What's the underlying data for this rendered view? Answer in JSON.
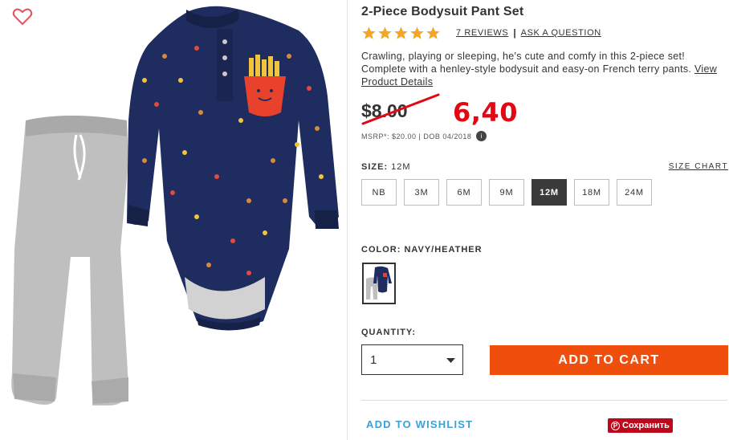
{
  "product": {
    "title": "2-Piece Bodysuit Pant Set",
    "rating": 5,
    "reviews_label": "7 REVIEWS",
    "separator": "|",
    "ask_label": "ASK A QUESTION",
    "description": "Crawling, playing or sleeping, he's cute and comfy in this 2-piece set! Complete with a henley-style bodysuit and easy-on French terry pants.",
    "details_link": "View Product Details"
  },
  "price": {
    "original": "$8.00",
    "handwritten_new": "6,40",
    "msrp_text": "MSRP*: $20.00 | DOB 04/2018",
    "info_icon": "i"
  },
  "size": {
    "label": "SIZE:",
    "selected": "12M",
    "chart_link": "SIZE CHART",
    "options": [
      "NB",
      "3M",
      "6M",
      "9M",
      "12M",
      "18M",
      "24M"
    ],
    "selected_index": 4
  },
  "color": {
    "label": "COLOR: NAVY/HEATHER"
  },
  "quantity": {
    "label": "QUANTITY:",
    "value": "1"
  },
  "actions": {
    "add_to_cart": "ADD TO CART",
    "wishlist": "ADD TO WISHLIST",
    "pinterest_save": "Сохранить",
    "pinterest_icon": "P"
  },
  "icons": {
    "favorite": "heart-outline-icon",
    "star": "star-icon",
    "dropdown": "caret-down-icon",
    "info": "info-icon",
    "pinterest": "pinterest-icon"
  },
  "colors": {
    "accent_cta": "#f04e0c",
    "star": "#f5a623",
    "heart": "#e8505b",
    "wishlist_link": "#3aa0d9",
    "handwritten_price": "#e30613",
    "pinterest": "#bd081c",
    "selected_size_bg": "#3a3a3a"
  }
}
